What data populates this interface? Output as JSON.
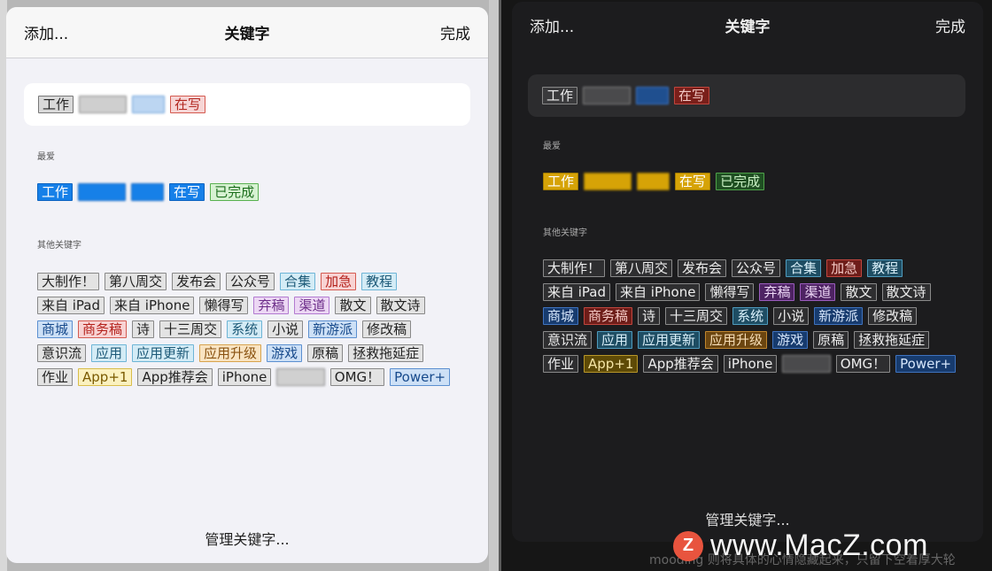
{
  "header": {
    "add_label": "添加...",
    "title": "关键字",
    "done_label": "完成"
  },
  "sections": {
    "favorites": "最爱",
    "others": "其他关键字"
  },
  "manage_label": "管理关键字...",
  "watermark": {
    "logo": "Z",
    "text": "www.MacZ.com"
  },
  "bottom_text": "mooding 则将具体的心情隐藏起来，只留下空着厚大轮",
  "light": {
    "selected": [
      {
        "label": "工作",
        "color": "#d9d9d9",
        "text": "#222",
        "border": "#777"
      },
      {
        "label": "xxxxx",
        "color": "#cfcfcf",
        "text": "#222",
        "border": "#888",
        "blur": true
      },
      {
        "label": "xxx",
        "color": "#bcd6f2",
        "text": "#222",
        "border": "#6a9fd8",
        "blur": true
      },
      {
        "label": "在写",
        "color": "#f6d5d5",
        "text": "#b2271f",
        "border": "#d45a50"
      }
    ],
    "favorites": [
      {
        "label": "工作",
        "color": "#1680e8",
        "text": "#fff",
        "border": "#0b63c1"
      },
      {
        "label": "xxxxx",
        "color": "#1680e8",
        "text": "#fff",
        "border": "#0b63c1",
        "blur": true
      },
      {
        "label": "xxx",
        "color": "#1680e8",
        "text": "#fff",
        "border": "#0b63c1",
        "blur": true
      },
      {
        "label": "在写",
        "color": "#1680e8",
        "text": "#fff",
        "border": "#0b63c1"
      },
      {
        "label": "已完成",
        "color": "#d7f2d2",
        "text": "#1c6e1c",
        "border": "#58b14f"
      }
    ],
    "others": [
      {
        "label": "大制作！",
        "color": "#e3e3e3",
        "text": "#222",
        "border": "#888"
      },
      {
        "label": "第八周交",
        "color": "#e3e3e3",
        "text": "#222",
        "border": "#888"
      },
      {
        "label": "发布会",
        "color": "#e3e3e3",
        "text": "#222",
        "border": "#888"
      },
      {
        "label": "公众号",
        "color": "#e3e3e3",
        "text": "#222",
        "border": "#888"
      },
      {
        "label": "合集",
        "color": "#d4ecf6",
        "text": "#1d5a78",
        "border": "#6eb5d6"
      },
      {
        "label": "加急",
        "color": "#f8d3d3",
        "text": "#b4221c",
        "border": "#d45a50"
      },
      {
        "label": "教程",
        "color": "#d4ecf6",
        "text": "#1d5a78",
        "border": "#6eb5d6"
      },
      {
        "label": "来自 iPad",
        "color": "#e3e3e3",
        "text": "#222",
        "border": "#888"
      },
      {
        "label": "来自 iPhone",
        "color": "#e3e3e3",
        "text": "#222",
        "border": "#888"
      },
      {
        "label": "懒得写",
        "color": "#e3e3e3",
        "text": "#222",
        "border": "#888"
      },
      {
        "label": "弃稿",
        "color": "#ecd7f4",
        "text": "#6c2d89",
        "border": "#b27ad0"
      },
      {
        "label": "渠道",
        "color": "#ecd7f4",
        "text": "#6c2d89",
        "border": "#b27ad0"
      },
      {
        "label": "散文",
        "color": "#e3e3e3",
        "text": "#222",
        "border": "#888"
      },
      {
        "label": "散文诗",
        "color": "#e3e3e3",
        "text": "#222",
        "border": "#888"
      },
      {
        "label": "商城",
        "color": "#cde0f6",
        "text": "#174a8c",
        "border": "#5b8fd0"
      },
      {
        "label": "商务稿",
        "color": "#f8d3d3",
        "text": "#b4221c",
        "border": "#d45a50"
      },
      {
        "label": "诗",
        "color": "#e3e3e3",
        "text": "#222",
        "border": "#888"
      },
      {
        "label": "十三周交",
        "color": "#e3e3e3",
        "text": "#222",
        "border": "#888"
      },
      {
        "label": "系统",
        "color": "#d4ecf6",
        "text": "#1d5a78",
        "border": "#6eb5d6"
      },
      {
        "label": "小说",
        "color": "#e3e3e3",
        "text": "#222",
        "border": "#888"
      },
      {
        "label": "新游派",
        "color": "#cde0f6",
        "text": "#174a8c",
        "border": "#5b8fd0"
      },
      {
        "label": "修改稿",
        "color": "#e3e3e3",
        "text": "#222",
        "border": "#888"
      },
      {
        "label": "意识流",
        "color": "#e3e3e3",
        "text": "#222",
        "border": "#888"
      },
      {
        "label": "应用",
        "color": "#d4ecf6",
        "text": "#1d5a78",
        "border": "#6eb5d6"
      },
      {
        "label": "应用更新",
        "color": "#d4ecf6",
        "text": "#1d5a78",
        "border": "#6eb5d6"
      },
      {
        "label": "应用升级",
        "color": "#f9e4c2",
        "text": "#8a5210",
        "border": "#d8a34d"
      },
      {
        "label": "游戏",
        "color": "#cde0f6",
        "text": "#174a8c",
        "border": "#5b8fd0"
      },
      {
        "label": "原稿",
        "color": "#e3e3e3",
        "text": "#222",
        "border": "#888"
      },
      {
        "label": "拯救拖延症",
        "color": "#e3e3e3",
        "text": "#222",
        "border": "#888"
      },
      {
        "label": "作业",
        "color": "#e3e3e3",
        "text": "#222",
        "border": "#888"
      },
      {
        "label": "App+1",
        "color": "#fbf1bf",
        "text": "#7a5a00",
        "border": "#d8bd4a"
      },
      {
        "label": "App推荐会",
        "color": "#e3e3e3",
        "text": "#222",
        "border": "#888"
      },
      {
        "label": "iPhone",
        "color": "#e3e3e3",
        "text": "#222",
        "border": "#888"
      },
      {
        "label": "xxxxx",
        "color": "#d0d0d0",
        "text": "#222",
        "border": "#888",
        "blur": true
      },
      {
        "label": "OMG！",
        "color": "#e3e3e3",
        "text": "#222",
        "border": "#888"
      },
      {
        "label": "Power+",
        "color": "#cde0f6",
        "text": "#174a8c",
        "border": "#5b8fd0"
      }
    ]
  },
  "dark": {
    "selected": [
      {
        "label": "工作",
        "color": "#3a3a3c",
        "text": "#eee",
        "border": "#888"
      },
      {
        "label": "xxxxx",
        "color": "#4a4a4c",
        "text": "#eee",
        "border": "#888",
        "blur": true
      },
      {
        "label": "xxx",
        "color": "#1f4f8f",
        "text": "#eee",
        "border": "#3d7ad0",
        "blur": true
      },
      {
        "label": "在写",
        "color": "#7a1f1a",
        "text": "#f3c8c4",
        "border": "#c0463e"
      }
    ],
    "favorites": [
      {
        "label": "工作",
        "color": "#d6a307",
        "text": "#fff",
        "border": "#a27b00"
      },
      {
        "label": "xxxxx",
        "color": "#d6a307",
        "text": "#fff",
        "border": "#a27b00",
        "blur": true
      },
      {
        "label": "xxx",
        "color": "#d6a307",
        "text": "#fff",
        "border": "#a27b00",
        "blur": true
      },
      {
        "label": "在写",
        "color": "#d6a307",
        "text": "#fff",
        "border": "#a27b00"
      },
      {
        "label": "已完成",
        "color": "#1f4f22",
        "text": "#c9f0c4",
        "border": "#4fa24a"
      }
    ],
    "others": [
      {
        "label": "大制作！",
        "color": "#2e2e30",
        "text": "#eee",
        "border": "#8a8a8a"
      },
      {
        "label": "第八周交",
        "color": "#2e2e30",
        "text": "#eee",
        "border": "#8a8a8a"
      },
      {
        "label": "发布会",
        "color": "#2e2e30",
        "text": "#eee",
        "border": "#8a8a8a"
      },
      {
        "label": "公众号",
        "color": "#2e2e30",
        "text": "#eee",
        "border": "#8a8a8a"
      },
      {
        "label": "合集",
        "color": "#1e4d63",
        "text": "#d9f0fa",
        "border": "#4f9bbd"
      },
      {
        "label": "加急",
        "color": "#6e1d19",
        "text": "#f4c9c5",
        "border": "#c0463e"
      },
      {
        "label": "教程",
        "color": "#1e4d63",
        "text": "#d9f0fa",
        "border": "#4f9bbd"
      },
      {
        "label": "来自 iPad",
        "color": "#2e2e30",
        "text": "#eee",
        "border": "#8a8a8a"
      },
      {
        "label": "来自 iPhone",
        "color": "#2e2e30",
        "text": "#eee",
        "border": "#8a8a8a"
      },
      {
        "label": "懒得写",
        "color": "#2e2e30",
        "text": "#eee",
        "border": "#8a8a8a"
      },
      {
        "label": "弃稿",
        "color": "#4e2363",
        "text": "#efd9f8",
        "border": "#9a5cbc"
      },
      {
        "label": "渠道",
        "color": "#4e2363",
        "text": "#efd9f8",
        "border": "#9a5cbc"
      },
      {
        "label": "散文",
        "color": "#2e2e30",
        "text": "#eee",
        "border": "#8a8a8a"
      },
      {
        "label": "散文诗",
        "color": "#2e2e30",
        "text": "#eee",
        "border": "#8a8a8a"
      },
      {
        "label": "商城",
        "color": "#173b6e",
        "text": "#d6e6fb",
        "border": "#3f73bf"
      },
      {
        "label": "商务稿",
        "color": "#6e1d19",
        "text": "#f4c9c5",
        "border": "#c0463e"
      },
      {
        "label": "诗",
        "color": "#2e2e30",
        "text": "#eee",
        "border": "#8a8a8a"
      },
      {
        "label": "十三周交",
        "color": "#2e2e30",
        "text": "#eee",
        "border": "#8a8a8a"
      },
      {
        "label": "系统",
        "color": "#1e4d63",
        "text": "#d9f0fa",
        "border": "#4f9bbd"
      },
      {
        "label": "小说",
        "color": "#2e2e30",
        "text": "#eee",
        "border": "#8a8a8a"
      },
      {
        "label": "新游派",
        "color": "#173b6e",
        "text": "#d6e6fb",
        "border": "#3f73bf"
      },
      {
        "label": "修改稿",
        "color": "#2e2e30",
        "text": "#eee",
        "border": "#8a8a8a"
      },
      {
        "label": "意识流",
        "color": "#2e2e30",
        "text": "#eee",
        "border": "#8a8a8a"
      },
      {
        "label": "应用",
        "color": "#1e4d63",
        "text": "#d9f0fa",
        "border": "#4f9bbd"
      },
      {
        "label": "应用更新",
        "color": "#1e4d63",
        "text": "#d9f0fa",
        "border": "#4f9bbd"
      },
      {
        "label": "应用升级",
        "color": "#6b4510",
        "text": "#f8dfb7",
        "border": "#c0862e"
      },
      {
        "label": "游戏",
        "color": "#173b6e",
        "text": "#d6e6fb",
        "border": "#3f73bf"
      },
      {
        "label": "原稿",
        "color": "#2e2e30",
        "text": "#eee",
        "border": "#8a8a8a"
      },
      {
        "label": "拯救拖延症",
        "color": "#2e2e30",
        "text": "#eee",
        "border": "#8a8a8a"
      },
      {
        "label": "作业",
        "color": "#2e2e30",
        "text": "#eee",
        "border": "#8a8a8a"
      },
      {
        "label": "App+1",
        "color": "#5e4a06",
        "text": "#f7e7a8",
        "border": "#b8972a"
      },
      {
        "label": "App推荐会",
        "color": "#2e2e30",
        "text": "#eee",
        "border": "#8a8a8a"
      },
      {
        "label": "iPhone",
        "color": "#2e2e30",
        "text": "#eee",
        "border": "#8a8a8a"
      },
      {
        "label": "xxxxx",
        "color": "#4a4a4c",
        "text": "#eee",
        "border": "#8a8a8a",
        "blur": true
      },
      {
        "label": "OMG！",
        "color": "#2e2e30",
        "text": "#eee",
        "border": "#8a8a8a"
      },
      {
        "label": "Power+",
        "color": "#173b6e",
        "text": "#d6e6fb",
        "border": "#3f73bf"
      }
    ]
  }
}
